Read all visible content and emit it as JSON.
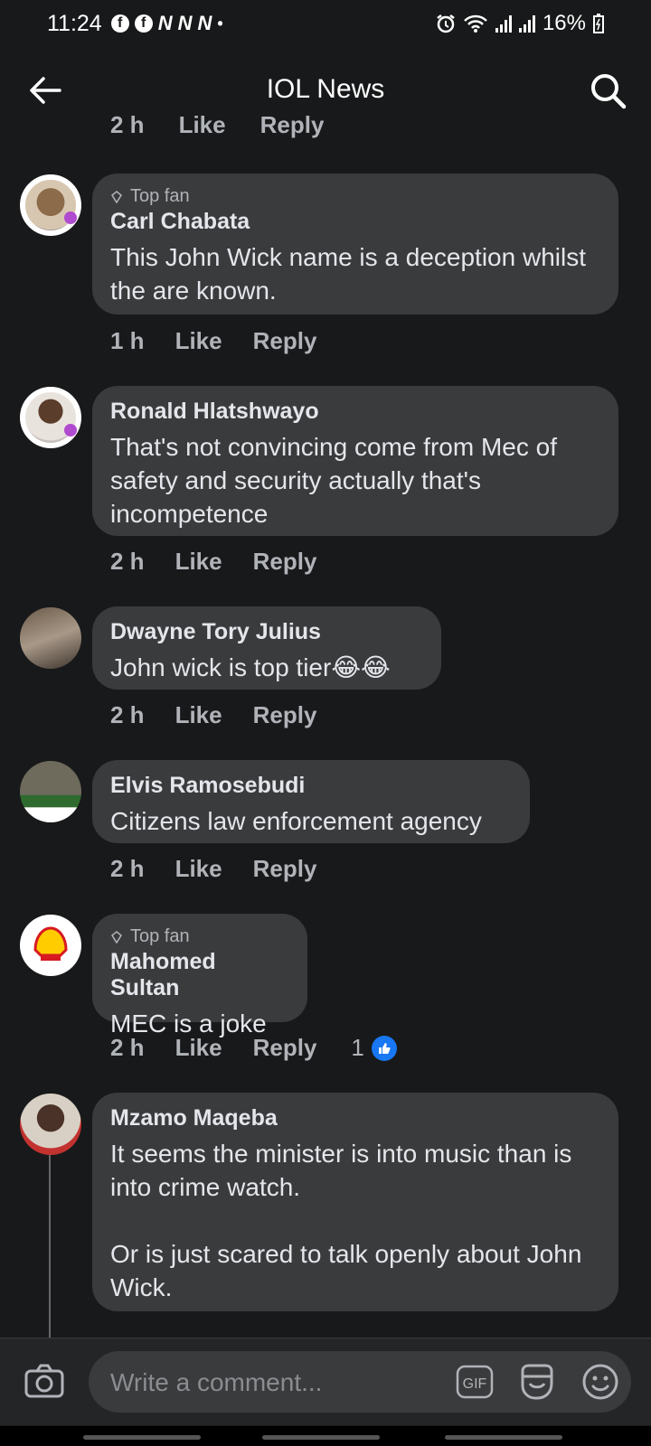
{
  "status": {
    "time": "11:24",
    "notification_icons": [
      "facebook-icon",
      "facebook-icon",
      "news24-icon",
      "news24-icon",
      "news24-icon"
    ],
    "notif_n": "N",
    "battery": "16%"
  },
  "header": {
    "title": "IOL News"
  },
  "previous_actions": {
    "time": "2 h",
    "like": "Like",
    "reply": "Reply"
  },
  "comments": [
    {
      "top_fan": true,
      "badge": "Top fan",
      "author": "Carl Chabata",
      "text": "This John Wick name is a deception whilst the are known.",
      "time": "1 h",
      "like": "Like",
      "reply": "Reply"
    },
    {
      "top_fan": false,
      "author": "Ronald Hlatshwayo",
      "text": "That's not convincing come from Mec of safety and security actually that's incompetence",
      "time": "2 h",
      "like": "Like",
      "reply": "Reply"
    },
    {
      "top_fan": false,
      "author": "Dwayne Tory Julius",
      "text": "John wick is top tier😂😂",
      "time": "2 h",
      "like": "Like",
      "reply": "Reply"
    },
    {
      "top_fan": false,
      "author": "Elvis Ramosebudi",
      "text": "Citizens law enforcement agency",
      "time": "2 h",
      "like": "Like",
      "reply": "Reply"
    },
    {
      "top_fan": true,
      "badge": "Top fan",
      "author": "Mahomed Sultan",
      "text": "MEC is a joke",
      "time": "2 h",
      "like": "Like",
      "reply": "Reply",
      "reaction_count": "1"
    },
    {
      "top_fan": false,
      "author": "Mzamo Maqeba",
      "text": "It seems the minister is into music than is into crime watch.\n\nOr is just scared to talk openly about John Wick.",
      "time": "",
      "like": "",
      "reply": ""
    }
  ],
  "composer": {
    "placeholder": "Write a comment...",
    "gif_label": "GIF"
  },
  "colors": {
    "background": "#18191a",
    "bubble": "#3a3b3c",
    "accent": "#1877f2",
    "muted": "#b0b3b8"
  }
}
